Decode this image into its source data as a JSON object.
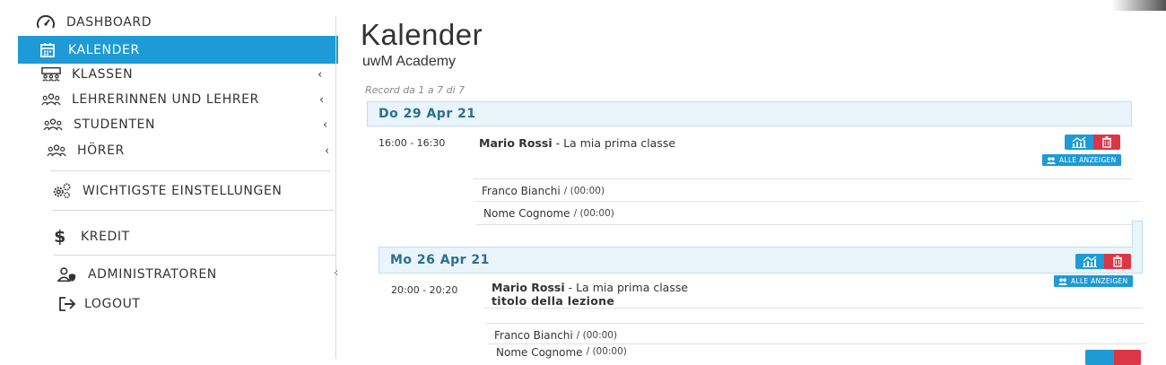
{
  "sidebar": {
    "items": [
      {
        "label": "DASHBOARD",
        "icon": "dashboard-gauge-icon"
      },
      {
        "label": "KALENDER",
        "icon": "calendar-icon",
        "active": true
      },
      {
        "label": "KLASSEN",
        "icon": "classroom-icon",
        "chevron": "‹"
      },
      {
        "label": "LEHRERINNEN UND LEHRER",
        "icon": "teachers-group-icon",
        "chevron": "‹"
      },
      {
        "label": "STUDENTEN",
        "icon": "students-group-icon",
        "chevron": "‹"
      },
      {
        "label": "HÖRER",
        "icon": "listeners-group-icon",
        "chevron": "‹"
      },
      {
        "label": "WICHTIGSTE EINSTELLUNGEN",
        "icon": "settings-gears-icon"
      },
      {
        "label": "KREDIT",
        "icon": "dollar-icon"
      },
      {
        "label": "ADMINISTRATOREN",
        "icon": "admin-user-shield-icon",
        "chevron": "‹"
      },
      {
        "label": "LOGOUT",
        "icon": "logout-icon"
      }
    ]
  },
  "main": {
    "title": "Kalender",
    "subtitle": "uwM Academy",
    "record_text": "Record da 1 a 7 di 7",
    "days": [
      {
        "date": "Do 29 Apr 21",
        "lessons": [
          {
            "time": "16:00 - 16:30",
            "teacher": "Mario Rossi",
            "class_name": " - La mia prima classe",
            "lesson_title": "",
            "show_all_label": "ALLE ANZEIGEN",
            "students": [
              {
                "name": "Franco Bianchi",
                "duration": "/ (00:00)"
              },
              {
                "name": "Nome Cognome",
                "duration": "/ (00:00)"
              }
            ]
          }
        ]
      },
      {
        "date": "Mo 26 Apr 21",
        "lessons": [
          {
            "time": "20:00 - 20:20",
            "teacher": "Mario Rossi",
            "class_name": " - La mia prima classe",
            "lesson_title": "titolo della lezione",
            "show_all_label": "ALLE ANZEIGEN",
            "students": [
              {
                "name": "Franco Bianchi",
                "duration": "/ (00:00)"
              },
              {
                "name": "Nome Cognome",
                "duration": "/ (00:00)"
              }
            ]
          }
        ]
      }
    ]
  },
  "colors": {
    "accent": "#1e9ad6",
    "danger": "#dc3545",
    "day_header_bg": "#e9f4fb",
    "day_header_text": "#2a6f8f"
  }
}
